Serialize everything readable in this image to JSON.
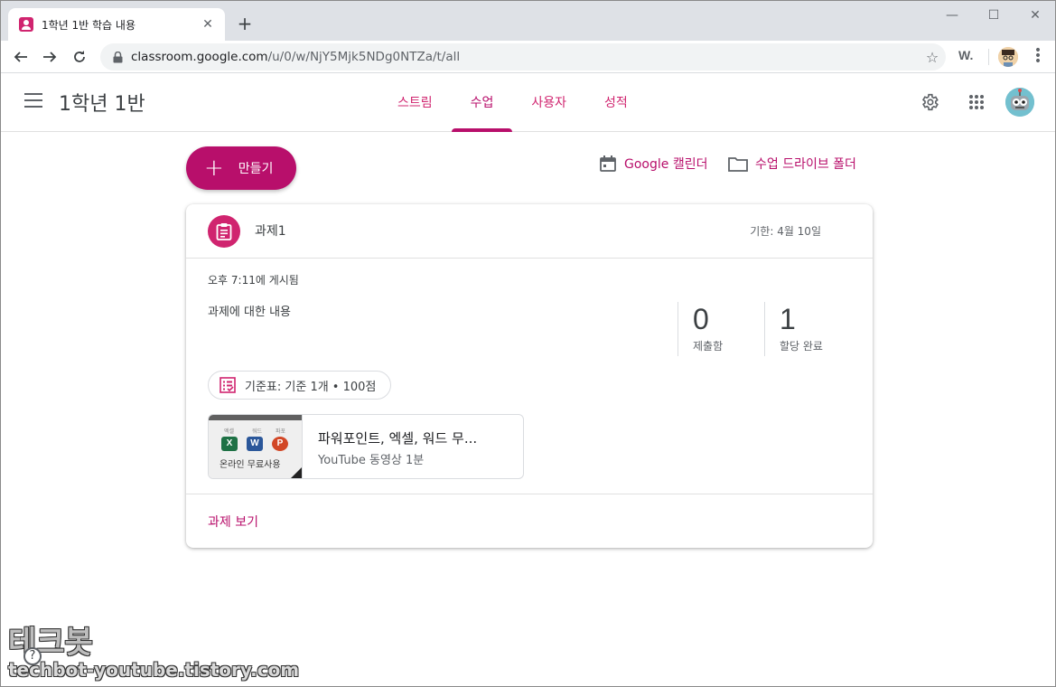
{
  "browser": {
    "tab_title": "1학년 1반 학습 내용",
    "tab_close": "✕",
    "new_tab": "+",
    "url_host": "classroom.google.com",
    "url_path": "/u/0/w/NjY5Mjk5NDg0NTZa/t/all",
    "extension_label": "W.",
    "window_controls": {
      "minimize": "—",
      "maximize": "☐",
      "close": "✕"
    }
  },
  "header": {
    "class_name": "1학년 1반",
    "tabs": [
      {
        "label": "스트림",
        "active": false
      },
      {
        "label": "수업",
        "active": true
      },
      {
        "label": "사용자",
        "active": false
      },
      {
        "label": "성적",
        "active": false
      }
    ]
  },
  "toolbar": {
    "create_label": "만들기",
    "calendar_label": "Google 캘린더",
    "drive_label": "수업 드라이브 폴더"
  },
  "assignment": {
    "title": "과제1",
    "due": "기한: 4월 10일",
    "posted": "오후 7:11에 게시됨",
    "description": "과제에 대한 내용",
    "stats": [
      {
        "value": "0",
        "label": "제출함"
      },
      {
        "value": "1",
        "label": "할당 완료"
      }
    ],
    "rubric": "기준표: 기준 1개 • 100점",
    "attachment": {
      "title": "파워포인트, 엑셀, 워드 무...",
      "subtitle": "YouTube 동영상   1분",
      "thumb_caption": "온라인 무료사용",
      "thumb_labels": [
        "엑셀",
        "워드",
        "파포"
      ],
      "thumb_letters": [
        "X",
        "W",
        "P"
      ]
    },
    "view_link": "과제 보기"
  },
  "help_label": "?",
  "watermark": {
    "title": "테크봇",
    "url": "techbot-youtube.tistory.com"
  },
  "colors": {
    "accent": "#b80f6b",
    "accent_light": "#d0246f"
  }
}
